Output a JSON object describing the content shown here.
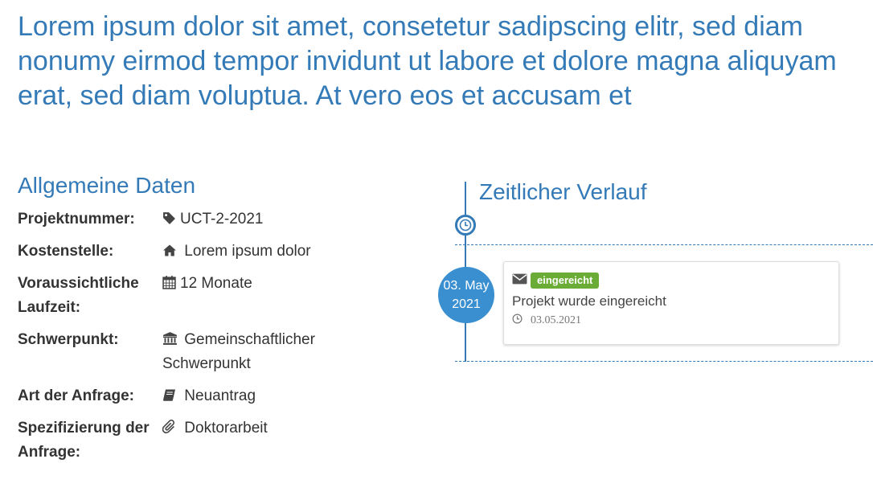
{
  "page": {
    "title": "Lorem ipsum dolor sit amet, consetetur sadipscing elitr, sed diam nonumy eirmod tempor invidunt ut labore et dolore magna aliquyam erat, sed diam voluptua. At vero eos et accusam et"
  },
  "general": {
    "heading": "Allgemeine Daten",
    "rows": [
      {
        "label": "Projektnummer:",
        "value": "UCT-2-2021",
        "icon": "tag-icon"
      },
      {
        "label": "Kostenstelle:",
        "value": "Lorem ipsum dolor",
        "icon": "home-icon"
      },
      {
        "label": "Voraussichtliche Laufzeit:",
        "value": "12 Monate",
        "icon": "calendar-icon"
      },
      {
        "label": "Schwerpunkt:",
        "value": "Gemeinschaftlicher Schwerpunkt",
        "icon": "institution-icon"
      },
      {
        "label": "Art der Anfrage:",
        "value": "Neuantrag",
        "icon": "book-icon"
      },
      {
        "label": "Spezifizierung der Anfrage:",
        "value": "Doktorarbeit",
        "icon": "paperclip-icon"
      }
    ]
  },
  "timeline": {
    "heading": "Zeitlicher Verlauf",
    "events": [
      {
        "date_day": "03. May",
        "date_year": "2021",
        "status": "eingereicht",
        "text": "Projekt wurde eingereicht",
        "date": "03.05.2021"
      }
    ]
  },
  "colors": {
    "primary": "#337ab7",
    "date_circle": "#3a8fd0",
    "status_badge": "#6aac36"
  }
}
